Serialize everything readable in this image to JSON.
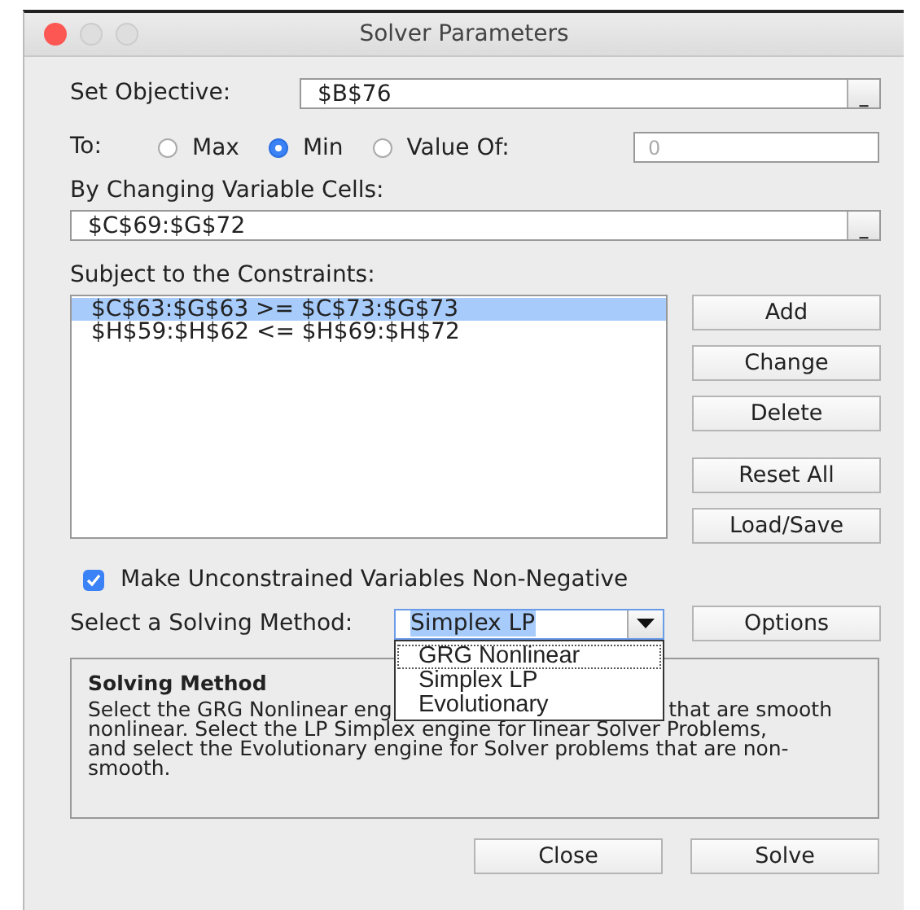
{
  "window": {
    "title": "Solver Parameters"
  },
  "objective": {
    "label": "Set Objective:",
    "value": "$B$76",
    "button": "_"
  },
  "to": {
    "label": "To:",
    "options": [
      {
        "label": "Max",
        "selected": false
      },
      {
        "label": "Min",
        "selected": true
      },
      {
        "label": "Value Of:",
        "selected": false
      }
    ],
    "value_field": {
      "value": "0",
      "disabled": true
    }
  },
  "changing_cells": {
    "label": "By Changing Variable Cells:",
    "value": "$C$69:$G$72",
    "button": "_"
  },
  "constraints": {
    "label": "Subject to the Constraints:",
    "items": [
      {
        "text": "$C$63:$G$63 >= $C$73:$G$73",
        "selected": true
      },
      {
        "text": "$H$59:$H$62 <= $H$69:$H$72",
        "selected": false
      }
    ]
  },
  "constraint_buttons": [
    [
      "Add",
      "Change",
      "Delete"
    ],
    [
      "Reset All",
      "Load/Save"
    ]
  ],
  "non_negative": {
    "label": "Make Unconstrained Variables Non-Negative",
    "checked": true
  },
  "method": {
    "label": "Select a Solving Method:",
    "value": "Simplex LP",
    "expanded": true,
    "options": [
      {
        "label": "GRG Nonlinear",
        "focused": true
      },
      {
        "label": "Simplex LP",
        "focused": false
      },
      {
        "label": "Evolutionary",
        "focused": false
      }
    ]
  },
  "options_button": "Options",
  "description": {
    "title": "Solving Method",
    "first_line": {
      "left": "Select the GRG Nonlinear eng",
      "right": "that are smooth"
    },
    "lines": [
      "nonlinear. Select the LP Simplex engine for linear Solver Problems,",
      "and select the Evolutionary engine for Solver problems that are non-",
      "smooth."
    ]
  },
  "footer_buttons": [
    "Close",
    "Solve"
  ]
}
